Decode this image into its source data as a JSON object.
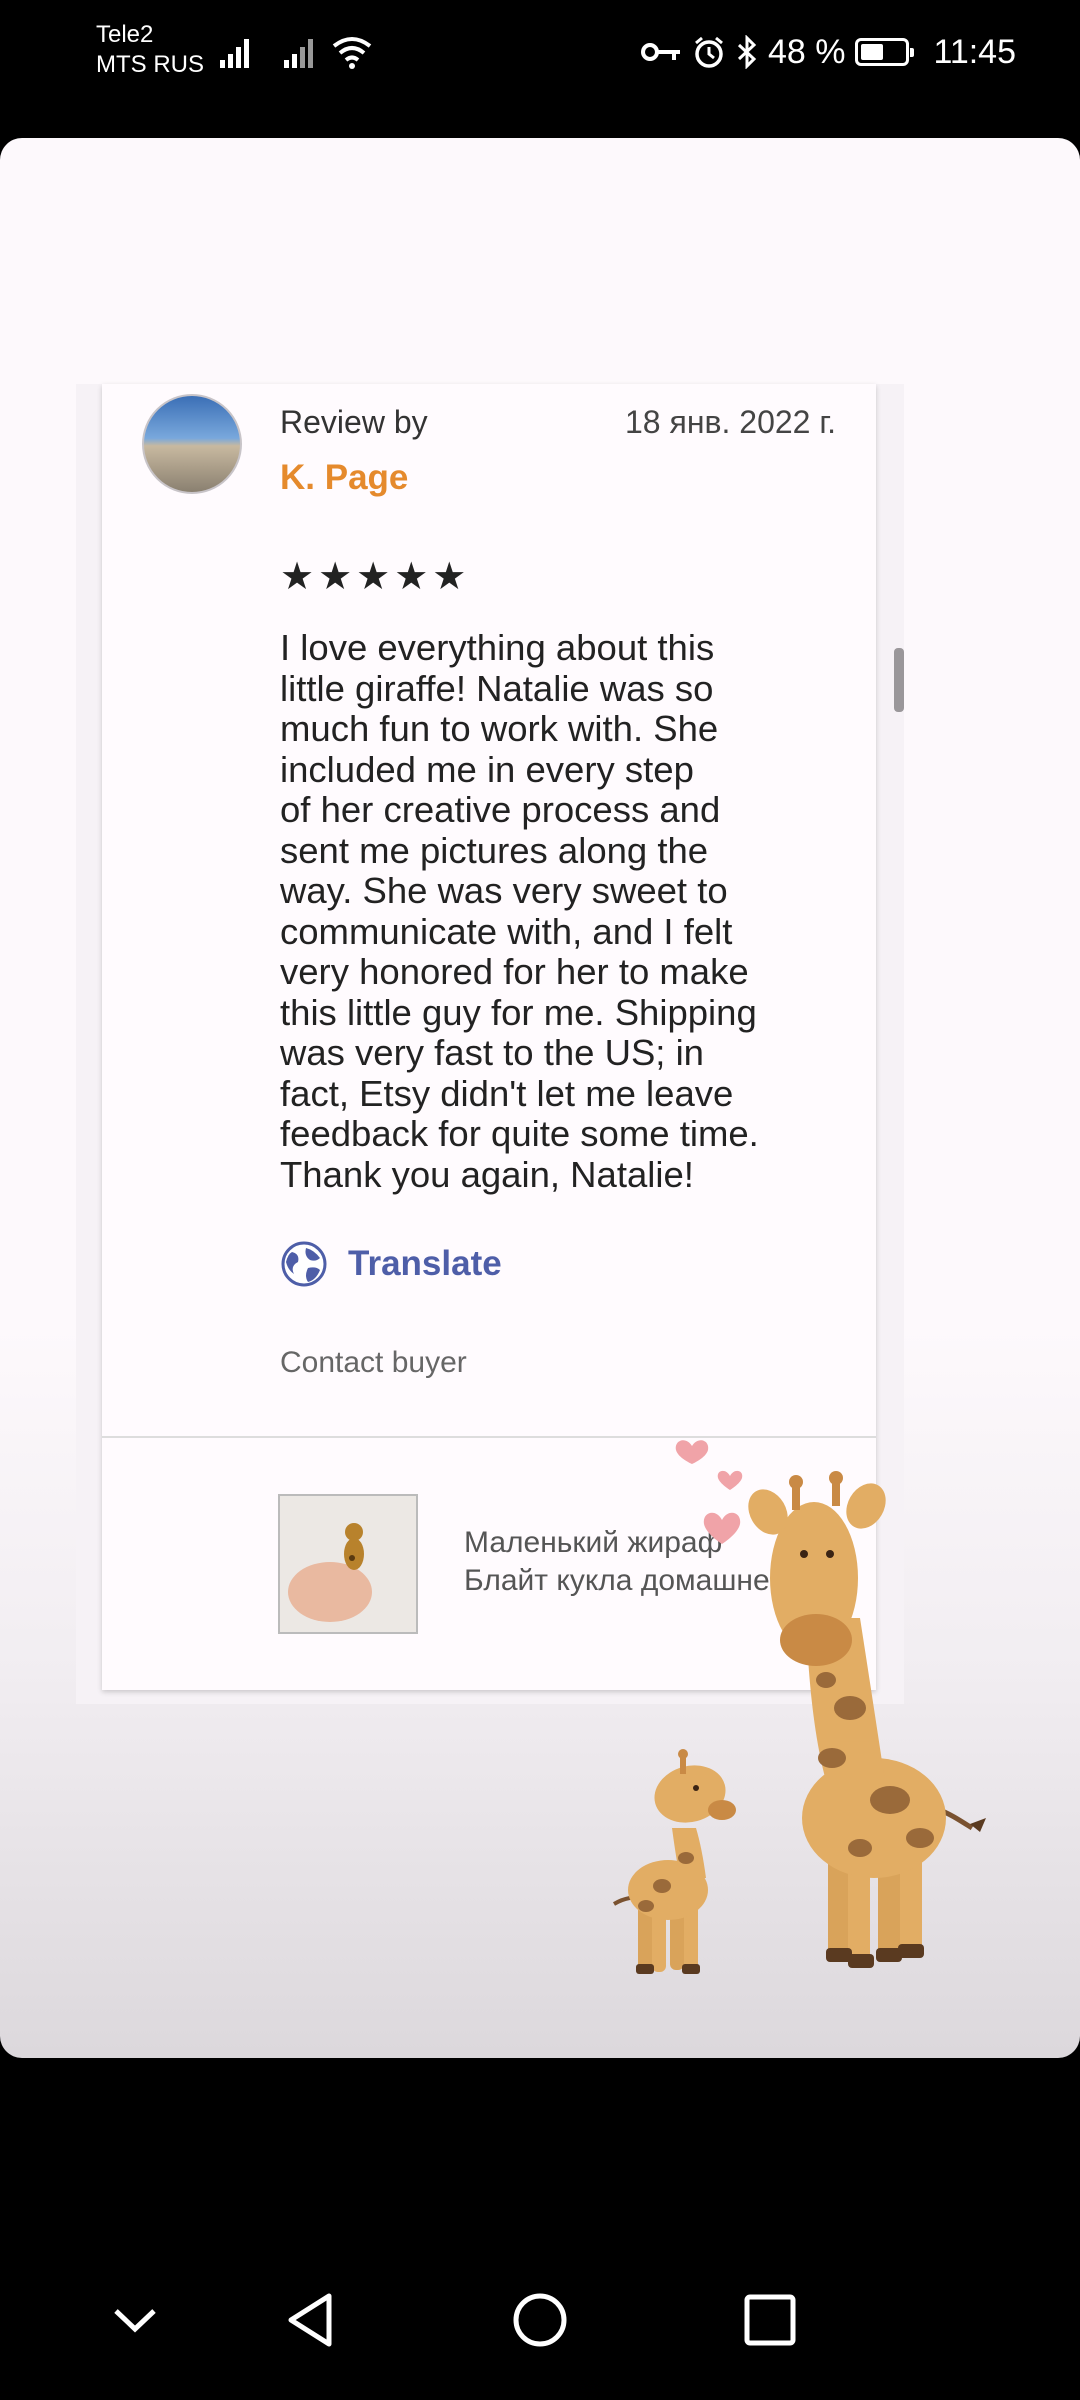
{
  "status_bar": {
    "carrier_1": "Tele2",
    "carrier_2": "MTS RUS",
    "battery": "48 %",
    "time": "11:45",
    "icons": [
      "signal-icon",
      "wifi-icon",
      "key-icon",
      "alarm-icon",
      "bluetooth-icon",
      "battery-icon"
    ]
  },
  "review": {
    "review_by": "Review by",
    "date": "18 янв. 2022 г.",
    "author": "K. Page",
    "rating_stars": 5,
    "stars": "★★★★★",
    "text": "I love everything about this\nlittle giraffe! Natalie was so\nmuch fun to work with. She\nincluded me in every step\nof her creative process and\nsent me pictures along the\nway. She was very sweet to\ncommunicate with, and I felt\nvery honored for her to make\nthis little guy for me. Shipping\nwas very fast to the US; in\nfact, Etsy didn't let me leave\nfeedback for quite some time.\nThank you again, Natalie!",
    "translate": "Translate",
    "contact": "Contact buyer",
    "listing_title": "Маленький жираф\nБлайт кукла домашне"
  },
  "colors": {
    "author": "#e58a2c",
    "translate": "#4e5ea8"
  },
  "nav": {
    "icons": [
      "chevron-down-icon",
      "back-icon",
      "home-icon",
      "recents-icon"
    ]
  }
}
